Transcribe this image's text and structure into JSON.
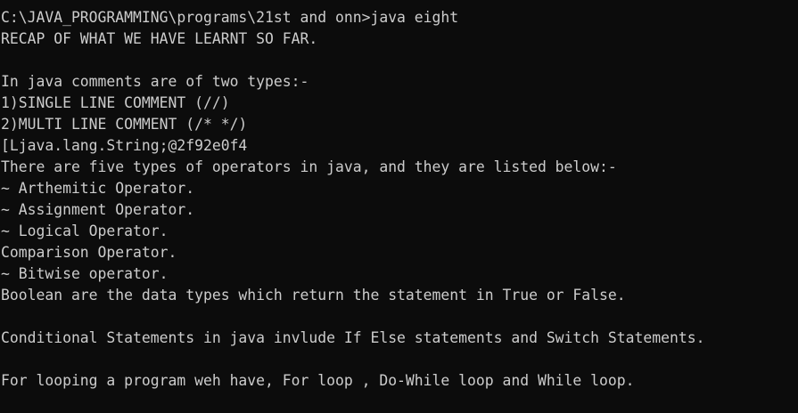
{
  "terminal": {
    "background": "#0c0c0c",
    "foreground": "#cccccc",
    "lines": [
      "C:\\JAVA_PROGRAMMING\\programs\\21st and onn>java eight",
      "RECAP OF WHAT WE HAVE LEARNT SO FAR.",
      "",
      "In java comments are of two types:-",
      "1)SINGLE LINE COMMENT (//)",
      "2)MULTI LINE COMMENT (/* */)",
      "[Ljava.lang.String;@2f92e0f4",
      "There are five types of operators in java, and they are listed below:-",
      "~ Arthemitic Operator.",
      "~ Assignment Operator.",
      "~ Logical Operator.",
      "Comparison Operator.",
      "~ Bitwise operator.",
      "Boolean are the data types which return the statement in True or False.",
      "",
      "Conditional Statements in java invlude If Else statements and Switch Statements.",
      "",
      "For looping a program weh have, For loop , Do-While loop and While loop."
    ]
  }
}
